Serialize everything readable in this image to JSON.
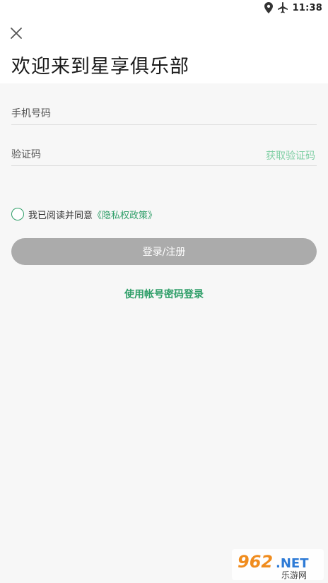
{
  "status_bar": {
    "time": "11:38",
    "icons": [
      "location-icon",
      "airplane-mode-icon"
    ]
  },
  "header": {
    "close_icon": "close-icon",
    "title": "欢迎来到星享俱乐部"
  },
  "form": {
    "phone_placeholder": "手机号码",
    "code_placeholder": "验证码",
    "get_code_label": "获取验证码"
  },
  "agreement": {
    "text": "我已阅读并同意",
    "policy_link": "《隐私权政策》"
  },
  "actions": {
    "login_button": "登录/注册",
    "alt_login": "使用帐号密码登录"
  },
  "watermark": {
    "logo_text": "962.NET",
    "sub_text": "乐游网"
  },
  "colors": {
    "accent_green": "#2e9e68",
    "light_green": "#7fcfa4",
    "button_disabled": "#ababab",
    "background": "#f7f7f7"
  }
}
